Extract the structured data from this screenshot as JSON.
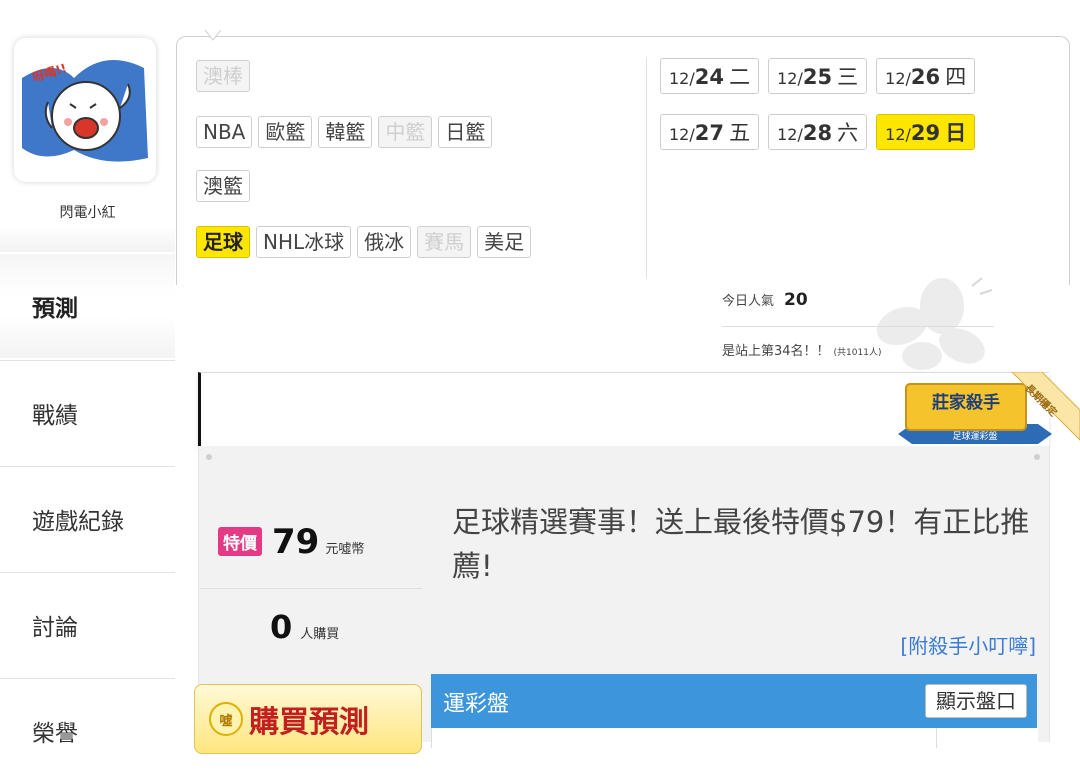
{
  "sidebar": {
    "username": "閃電小紅",
    "avatar_text": "呀喝!!",
    "nav": [
      {
        "label": "預測",
        "active": true
      },
      {
        "label": "戰績",
        "active": false
      },
      {
        "label": "遊戲紀錄",
        "active": false
      },
      {
        "label": "討論",
        "active": false
      },
      {
        "label": "榮譽",
        "active": false
      }
    ]
  },
  "sports": {
    "row1": [
      {
        "label": "澳棒",
        "state": "disabled"
      }
    ],
    "row2": [
      {
        "label": "NBA",
        "state": "normal"
      },
      {
        "label": "歐籃",
        "state": "normal"
      },
      {
        "label": "韓籃",
        "state": "normal"
      },
      {
        "label": "中籃",
        "state": "disabled"
      },
      {
        "label": "日籃",
        "state": "normal"
      }
    ],
    "row3": [
      {
        "label": "澳籃",
        "state": "normal"
      }
    ],
    "row4": [
      {
        "label": "足球",
        "state": "selected"
      },
      {
        "label": "NHL冰球",
        "state": "normal"
      },
      {
        "label": "俄冰",
        "state": "normal"
      },
      {
        "label": "賽馬",
        "state": "disabled"
      },
      {
        "label": "美足",
        "state": "normal"
      }
    ]
  },
  "dates": {
    "row1": [
      {
        "md": "12/",
        "d": "24",
        "wd": "二",
        "selected": false
      },
      {
        "md": "12/",
        "d": "25",
        "wd": "三",
        "selected": false
      },
      {
        "md": "12/",
        "d": "26",
        "wd": "四",
        "selected": false
      }
    ],
    "row2": [
      {
        "md": "12/",
        "d": "27",
        "wd": "五",
        "selected": false
      },
      {
        "md": "12/",
        "d": "28",
        "wd": "六",
        "selected": false
      },
      {
        "md": "12/",
        "d": "29",
        "wd": "日",
        "selected": true
      }
    ]
  },
  "stats": {
    "popularity_label": "今日人氣",
    "popularity_value": "20",
    "rank_text": "是站上第34名！！",
    "rank_total": "(共1011人)"
  },
  "badge": {
    "title": "莊家殺手",
    "subtitle": "足球運彩盤",
    "ribbon": "長期穩定"
  },
  "offer": {
    "special_tag": "特價",
    "price": "79",
    "price_unit": "元噓幣",
    "buyers": "0",
    "buyers_unit": "人購買",
    "buy_coin": "噓",
    "buy_button": "購買預測",
    "headline": "足球精選賽事！送上最後特價$79！有正比推薦!",
    "tips_link": "[附殺手小叮嚀]"
  },
  "lottery": {
    "title": "運彩盤",
    "show_odds": "顯示盤口"
  },
  "colors": {
    "selected_yellow": "#ffe600",
    "special_pink": "#e43a86",
    "lottery_blue": "#3d95dc",
    "link_blue": "#3a7bd5"
  }
}
